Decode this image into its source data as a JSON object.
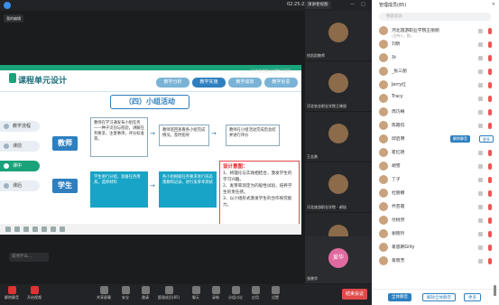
{
  "topbar": {
    "time": "02:25:23",
    "view_button": "演讲者视图",
    "speaking": "我的编辑"
  },
  "slide": {
    "title": "课程单元设计",
    "tabs": [
      "教学分析",
      "教学实施",
      "教学成效",
      "教学反思"
    ],
    "subtitle": "（四）小组活动",
    "nav": [
      "教学流程",
      "课前",
      "课中",
      "课后"
    ],
    "teacher_label": "教师",
    "student_label": "学生",
    "teacher_box1": "教师在学习通发布小组任务——种子识别与检验，讲解任务要求，注意事项，评分标准等。",
    "teacher_box2": "教师巡回查看各小组完成情况，及时指导",
    "teacher_box3": "教师在小组活动完成后总结并进行评价",
    "student_box1": "学生进行分组，准备任务用具，选择材料",
    "student_box2": "各小组根据任务要求进行形态观察和记录，进行发芽率测试",
    "intent_title": "设计意图：",
    "intent_lines": [
      "1、将理论与实践相结合，激发学生的学习兴趣。",
      "2、发芽率测定为的般性试验，培养学生的责任感。",
      "3、以小组形式激发学生的合作探究能力。"
    ]
  },
  "chat_input": "说点什么...",
  "videos": [
    {
      "label": "河北旅游职业学院王丽丽"
    },
    {
      "label": "徐凯凯教师"
    },
    {
      "label": "河北农业职业学院王晓丽"
    },
    {
      "label": "王志勇"
    },
    {
      "label": "河北旅游职业学院 · 郝旭"
    },
    {
      "label": "艺术设计学院"
    },
    {
      "label": "张晓华"
    }
  ],
  "avatar_text": "爱华",
  "toolbar": {
    "items": [
      "解除静音",
      "开启视频",
      "共享屏幕",
      "安全",
      "邀请",
      "管理成员(85)",
      "聊天",
      "录制",
      "分组讨论",
      "应用",
      "设置"
    ],
    "end": "结束会议"
  },
  "panel": {
    "header": "管理成员(85)",
    "search_placeholder": "搜索成员",
    "members": [
      {
        "name": "河北旅游职业学院王丽丽",
        "sub": "(主持人，我)"
      },
      {
        "name": "刘昕",
        "sub": ""
      },
      {
        "name": "孙",
        "sub": ""
      },
      {
        "name": "_张三丽",
        "sub": ""
      },
      {
        "name": "Jerry红",
        "sub": ""
      },
      {
        "name": "Tracy",
        "sub": ""
      },
      {
        "name": "周巧梅",
        "sub": ""
      },
      {
        "name": "陈霞钧",
        "sub": ""
      },
      {
        "name": "邱启明",
        "sub": ""
      },
      {
        "name": "崔红艳",
        "sub": ""
      },
      {
        "name": "胡雪",
        "sub": ""
      },
      {
        "name": "丁子",
        "sub": ""
      },
      {
        "name": "杜丽娜",
        "sub": ""
      },
      {
        "name": "乔芸霞",
        "sub": ""
      },
      {
        "name": "付桃然",
        "sub": ""
      },
      {
        "name": "谢晓玲",
        "sub": ""
      },
      {
        "name": "蒋思韩Gilty",
        "sub": ""
      },
      {
        "name": "蒋晓芳",
        "sub": ""
      }
    ],
    "inline_btn1": "解除静音",
    "inline_btn2": "更多",
    "bottom_btns": [
      "全体静音",
      "解除全体静音",
      "更多"
    ]
  }
}
